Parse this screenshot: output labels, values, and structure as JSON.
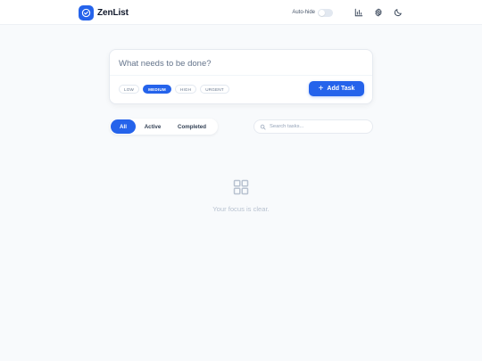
{
  "app": {
    "name": "ZenList",
    "accent": "#2563eb"
  },
  "header": {
    "autohide_label": "Auto-hide",
    "autohide_on": false,
    "icons": [
      "bar-chart-icon",
      "gear-icon",
      "moon-icon"
    ]
  },
  "composer": {
    "placeholder": "What needs to be done?",
    "value": "",
    "priorities": [
      {
        "label": "LOW",
        "selected": false
      },
      {
        "label": "MEDIUM",
        "selected": true
      },
      {
        "label": "HIGH",
        "selected": false
      },
      {
        "label": "URGENT",
        "selected": false
      }
    ],
    "add_label": "Add Task",
    "add_icon": "plus-icon"
  },
  "filters": {
    "tabs": [
      {
        "label": "All",
        "selected": true
      },
      {
        "label": "Active",
        "selected": false
      },
      {
        "label": "Completed",
        "selected": false
      }
    ]
  },
  "search": {
    "placeholder": "Search tasks...",
    "value": "",
    "icon": "search-icon"
  },
  "empty_state": {
    "icon": "grid-icon",
    "text": "Your focus is clear."
  }
}
